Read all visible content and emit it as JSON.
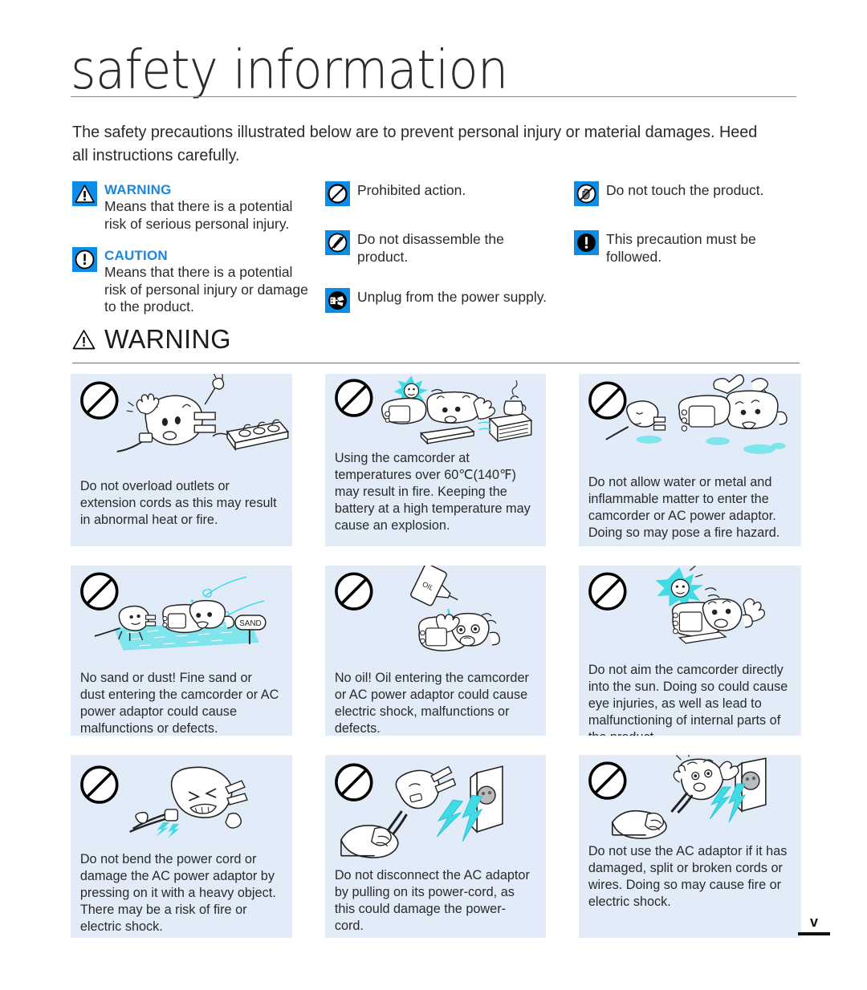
{
  "page": {
    "title": "safety information",
    "folio": "v",
    "accent_blue": "#0c8ce9",
    "heading_blue": "#1a86e0",
    "panel_bg": "#e2ecf8",
    "cyan": "#3fe0e0"
  },
  "intro": "The safety precautions illustrated below are to prevent personal injury or material damages. Heed all instructions carefully.",
  "legend": {
    "col1": [
      {
        "icon": "warning-triangle-icon",
        "heading": "WARNING",
        "text": "Means that there is a potential risk of serious personal injury."
      },
      {
        "icon": "caution-exclamation-icon",
        "heading": "CAUTION",
        "text": "Means that there is a potential risk of personal injury or damage to the product."
      }
    ],
    "col2": [
      {
        "icon": "prohibited-action-icon",
        "text": "Prohibited action."
      },
      {
        "icon": "do-not-disassemble-icon",
        "text": "Do not disassemble the product."
      },
      {
        "icon": "unplug-power-icon",
        "text": "Unplug from the power supply."
      }
    ],
    "col3": [
      {
        "icon": "do-not-touch-icon",
        "text": "Do not touch the product."
      },
      {
        "icon": "must-be-followed-icon",
        "text": "This precaution must be followed."
      }
    ]
  },
  "section": {
    "icon": "warning-triangle-outline-icon",
    "label": "WARNING"
  },
  "panels": [
    {
      "id": "overload-outlets",
      "art": "plug-and-power-strip",
      "caption": "Do not overload outlets or extension cords as this may result in abnormal heat or fire."
    },
    {
      "id": "high-temperature",
      "art": "camcorder-heat-stove",
      "caption": "Using the camcorder at temperatures over 60℃(140℉) may result in fire. Keeping the battery at a high temperature may cause an explosion."
    },
    {
      "id": "water-or-metal",
      "art": "camcorder-water-splash",
      "caption": "Do not allow water or metal and inflammable matter to enter the camcorder or AC power adaptor. Doing so may pose a fire hazard."
    },
    {
      "id": "no-sand-or-dust",
      "art": "camcorder-on-sand",
      "caption": "No sand or dust! Fine sand or dust entering the camcorder or AC power adaptor could cause malfunctions or defects.",
      "art_label": "SAND"
    },
    {
      "id": "no-oil",
      "art": "oil-bottle-dripping",
      "caption": "No oil! Oil entering the camcorder or AC power adaptor could cause electric shock, malfunctions or defects."
    },
    {
      "id": "no-direct-sun",
      "art": "camcorder-pointing-at-sun",
      "caption": "Do not aim the camcorder directly into the sun. Doing so could cause eye injuries, as well as lead to malfunctioning of internal parts of the product."
    },
    {
      "id": "do-not-bend-cord",
      "art": "bent-power-adaptor",
      "caption": "Do not bend the power cord or damage the AC power adaptor by pressing on it with a heavy object. There may be a risk of fire or electric shock."
    },
    {
      "id": "do-not-pull-cord",
      "art": "hand-pulling-cord-from-outlet",
      "caption": "Do not disconnect the AC adaptor by pulling on its power-cord, as this could damage the power-cord."
    },
    {
      "id": "damaged-adaptor",
      "art": "damaged-adaptor-sparking",
      "caption": "Do not use the AC adaptor if it has damaged, split or broken cords or wires. Doing so may cause fire or electric shock."
    }
  ]
}
